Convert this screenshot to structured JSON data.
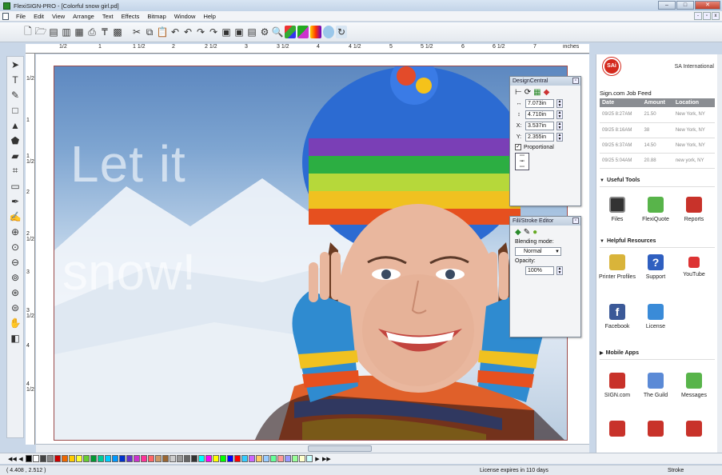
{
  "window": {
    "title": "FlexiSIGN-PRO - [Colorful snow girl.pd]"
  },
  "menu": [
    "File",
    "Edit",
    "View",
    "Arrange",
    "Text",
    "Effects",
    "Bitmap",
    "Window",
    "Help"
  ],
  "ruler": {
    "units": "inches",
    "top_labels": [
      "1/2",
      "1",
      "1 1/2",
      "2",
      "2 1/2",
      "3",
      "3 1/2",
      "4",
      "4 1/2",
      "5",
      "5 1/2",
      "6",
      "6 1/2",
      "7"
    ],
    "left_labels": [
      "1/2",
      "1",
      "1 1/2",
      "2",
      "2 1/2",
      "3",
      "3 1/2",
      "4",
      "4 1/2"
    ]
  },
  "canvas": {
    "line1": "Let it",
    "line2": "snow!"
  },
  "design_central": {
    "title": "DesignCentral",
    "width": "7.073in",
    "height": "4.710in",
    "x": "3.537in",
    "y": "2.355in",
    "proportional_label": "Proportional",
    "proportional_checked": true
  },
  "fill_stroke": {
    "title": "Fill/Stroke Editor",
    "blending_label": "Blending mode:",
    "blending_value": "Normal",
    "opacity_label": "Opacity:",
    "opacity_value": "100%"
  },
  "right_panel": {
    "brand_mark": "SAi",
    "brand_name": "SA International",
    "feed_title": "Sign.com Job Feed",
    "feed_headers": [
      "Date",
      "Amount",
      "Location"
    ],
    "feed_rows": [
      [
        "09/25 8:27AM",
        "21.50",
        "New York, NY"
      ],
      [
        "09/25 8:16AM",
        "38",
        "New York, NY"
      ],
      [
        "09/25 6:37AM",
        "14.50",
        "New York, NY"
      ],
      [
        "09/25 5:04AM",
        "20.88",
        "new york, NY"
      ]
    ],
    "sections": {
      "tools": "Useful Tools",
      "resources": "Helpful Resources",
      "mobile": "Mobile Apps"
    },
    "tools": [
      "Files",
      "FlexiQuote",
      "Reports"
    ],
    "resources": [
      "Printer Profiles",
      "Support",
      "YouTube",
      "Facebook",
      "License"
    ],
    "mobile": [
      "SIGN.com",
      "The Guild",
      "Messages"
    ]
  },
  "status": {
    "coords": "( 4.408 , 2.512 )",
    "license": "License expires in 110 days",
    "mode": "Stroke"
  },
  "colors": {
    "accent_red": "#d42a1e",
    "selection": "#9a4a4a"
  }
}
